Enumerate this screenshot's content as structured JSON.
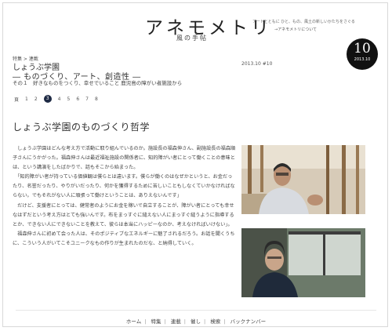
{
  "site": {
    "logo": "アネモメトリ",
    "logo_sub": "風の手帖",
    "tagline": "アートとともに ひと、もの、風土の新しいかたちをさぐる",
    "about_link": "→アネモメトリについて"
  },
  "issue": {
    "number": "10",
    "year": "2013.10"
  },
  "article": {
    "breadcrumb": "特集 > 連載",
    "title_line1": "しょうぶ学園",
    "title_line2": "― ものづくり、アート、創造性 ―",
    "date": "2013.10 #10",
    "subtitle": "その１　好きなものをつくり、幸せでいること 鹿児島の障がい者施設から",
    "heading": "しょうぶ学園のものづくり哲学",
    "paragraphs": [
      "　しょうぶ学園はどんな考え方で活動に取り組んでいるのか。施設長の福森伸さん、副施設長の福森順子さんにうかがった。福森伸さんは最近福祉施設の関係者に、知的障がい者にとって働くことの意味とは、という講演をしたばかりで、話もそこから始まった。",
      "　「知的障がい者が持っている価値観は僕らとは違います。僕らが働くのはなぜかというと、お金だったり、名誉だったり、やりがいだったり、何かを獲得するために苦しいこともしなくていかなければならない。でもそれがない人に頑張って働けということは、ありえないんです」",
      "　だけど、支援者にとっては、健常者のようにお金を稼いで自立することが、障がい者にとっても幸せなはずだという考え方はとても強いんです。布をまっすぐに縫えない人にまっすぐ縫うように指導するとか、できない人にできないことを教えて、彼らは本当にハッピーなのか、考えなければいけない」。",
      "　福森伸さんに初めて会った人は、そのポジティブなエネルギーに魅了されるだろう。お話を聞くうちに、こういう人がいてこそユニークなもの作りが生まれたのだな、と納得していく。"
    ]
  },
  "pager": {
    "label": "頁",
    "pages": [
      "1",
      "2",
      "3",
      "4",
      "5",
      "6",
      "7",
      "8"
    ],
    "current": "3"
  },
  "footer": {
    "links": [
      "ホーム",
      "特集",
      "連載",
      "催し",
      "検索",
      "バックナンバー"
    ]
  }
}
